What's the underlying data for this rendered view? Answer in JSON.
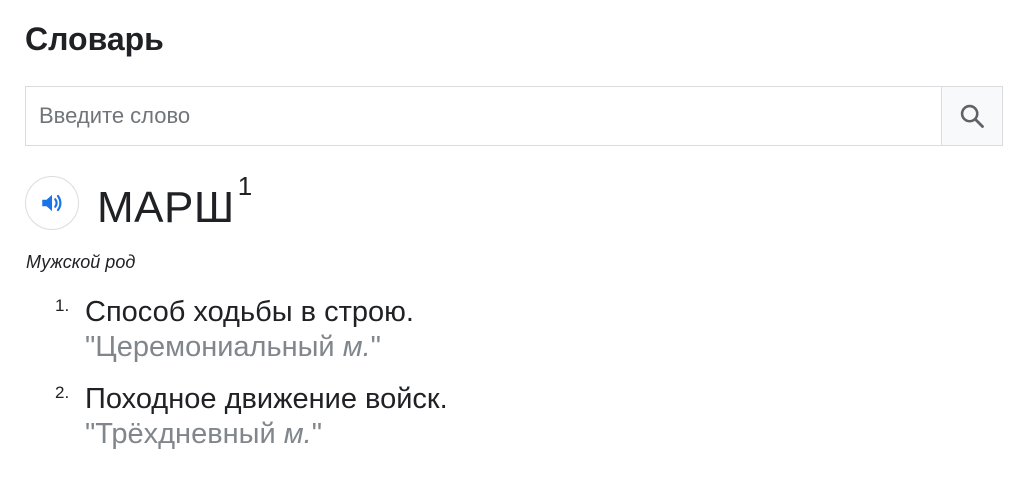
{
  "header": {
    "title": "Словарь"
  },
  "search": {
    "placeholder": "Введите слово",
    "value": ""
  },
  "entry": {
    "headword": "МАРШ",
    "homograph": "1",
    "part_of_speech": "Мужской род",
    "senses": [
      {
        "number": "1.",
        "definition": "Способ ходьбы в строю.",
        "example_open": "\"Церемониальный ",
        "example_abbr": "м.",
        "example_close": "\""
      },
      {
        "number": "2.",
        "definition": "Походное движение войск.",
        "example_open": "\"Трёхдневный ",
        "example_abbr": "м.",
        "example_close": "\""
      }
    ]
  },
  "icons": {
    "search": "search-icon",
    "audio": "speaker-icon"
  },
  "colors": {
    "accent": "#1a73e8",
    "text": "#202124",
    "muted": "#80868b",
    "border": "#dadce0"
  }
}
